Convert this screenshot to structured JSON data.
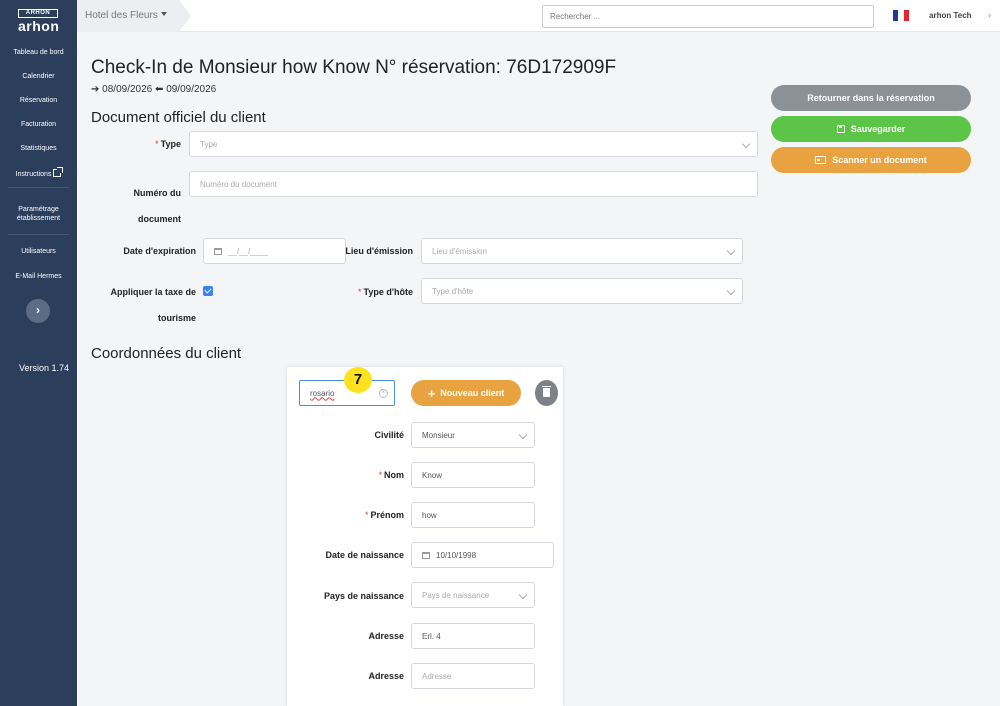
{
  "sidebar": {
    "logo_top": "ARHON",
    "logo_main": "arhon",
    "items": [
      {
        "label": "Tableau de bord"
      },
      {
        "label": "Calendrier"
      },
      {
        "label": "Réservation"
      },
      {
        "label": "Facturation"
      },
      {
        "label": "Statistiques"
      },
      {
        "label": "Instructions"
      },
      {
        "label": "Paramétrage établissement"
      },
      {
        "label": "Utilisateurs"
      },
      {
        "label": "E-Mail Hermes"
      }
    ],
    "expand_glyph": "›",
    "version": "Version 1.74"
  },
  "topbar": {
    "hotel": "Hotel des Fleurs",
    "search_placeholder": "Rechercher ...",
    "user": "arhon Tech",
    "user_caret": "›",
    "flag_colors": [
      "#1f3a93",
      "#ffffff",
      "#e1262d"
    ]
  },
  "header": {
    "title": "Check-In de Monsieur how Know N° réservation: 76D172909F",
    "arrival": "08/09/2026",
    "departure": "09/09/2026"
  },
  "actions": {
    "back": "Retourner dans la réservation",
    "save": "Sauvegarder",
    "scan": "Scanner un document"
  },
  "document": {
    "section_title": "Document officiel du client",
    "type_label": "Type",
    "type_placeholder": "Type",
    "number_label_1": "Numéro du",
    "number_label_2": "document",
    "number_placeholder": "Numéro du document",
    "expiry_label": "Date d'expiration",
    "expiry_placeholder": "__/__/____",
    "issue_place_label": "Lieu d'émission",
    "issue_place_placeholder": "Lieu d'émission",
    "tax_label_1": "Appliquer la taxe de",
    "tax_label_2": "tourisme",
    "tax_checked": true,
    "host_type_label": "Type d'hôte",
    "host_type_placeholder": "Type d'hôte"
  },
  "client": {
    "section_title": "Coordonnées du client",
    "search_value": "rosario",
    "badge": "7",
    "new_client": "Nouveau client",
    "civility_label": "Civilité",
    "civility_value": "Monsieur",
    "lastname_label": "Nom",
    "lastname_value": "Know",
    "firstname_label": "Prénom",
    "firstname_value": "how",
    "birthdate_label": "Date de naissance",
    "birthdate_value": "10/10/1998",
    "birth_country_label": "Pays de naissance",
    "birth_country_placeholder": "Pays de naissance",
    "address_label": "Adresse",
    "address_value": "Erl. 4",
    "address2_label": "Adresse",
    "address2_placeholder": "Adresse"
  }
}
